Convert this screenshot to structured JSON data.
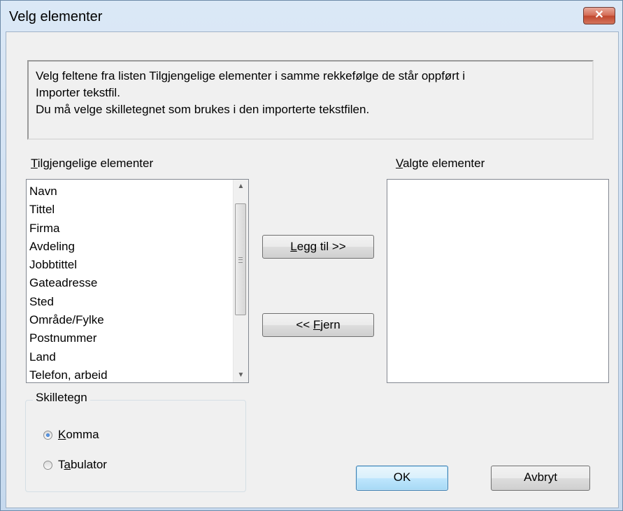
{
  "window": {
    "title": "Velg elementer",
    "close_glyph": "✕"
  },
  "info": {
    "line1": "Velg feltene fra listen Tilgjengelige elementer i samme rekkefølge de står oppført i",
    "line2": "Importer tekstfil.",
    "line3": "Du må velge skilletegnet som brukes i den importerte tekstfilen."
  },
  "available": {
    "label_accel": "T",
    "label_rest": "ilgjengelige elementer",
    "items": [
      "Navn",
      "Tittel",
      "Firma",
      "Avdeling",
      "Jobbtittel",
      "Gateadresse",
      "Sted",
      "Område/Fylke",
      "Postnummer",
      "Land",
      "Telefon, arbeid"
    ]
  },
  "selected": {
    "label_accel": "V",
    "label_rest": "algte elementer",
    "items": []
  },
  "buttons": {
    "add_accel": "L",
    "add_rest": "egg til >>",
    "remove_pre": "<< ",
    "remove_accel": "F",
    "remove_rest": "jern",
    "ok": "OK",
    "cancel": "Avbryt"
  },
  "delimiter": {
    "title": "Skilletegn",
    "options": [
      {
        "accel": "K",
        "rest": "omma",
        "checked": true
      },
      {
        "pre": "T",
        "accel": "a",
        "rest": "bulator",
        "checked": false
      }
    ]
  },
  "icons": {
    "close": "close-icon",
    "scroll_up": "scroll-up-arrow-icon",
    "scroll_down": "scroll-down-arrow-icon"
  },
  "colors": {
    "close_button": "#c0462d",
    "title_bar": "#c6d9ee",
    "default_button_border": "#3c7fb1"
  }
}
